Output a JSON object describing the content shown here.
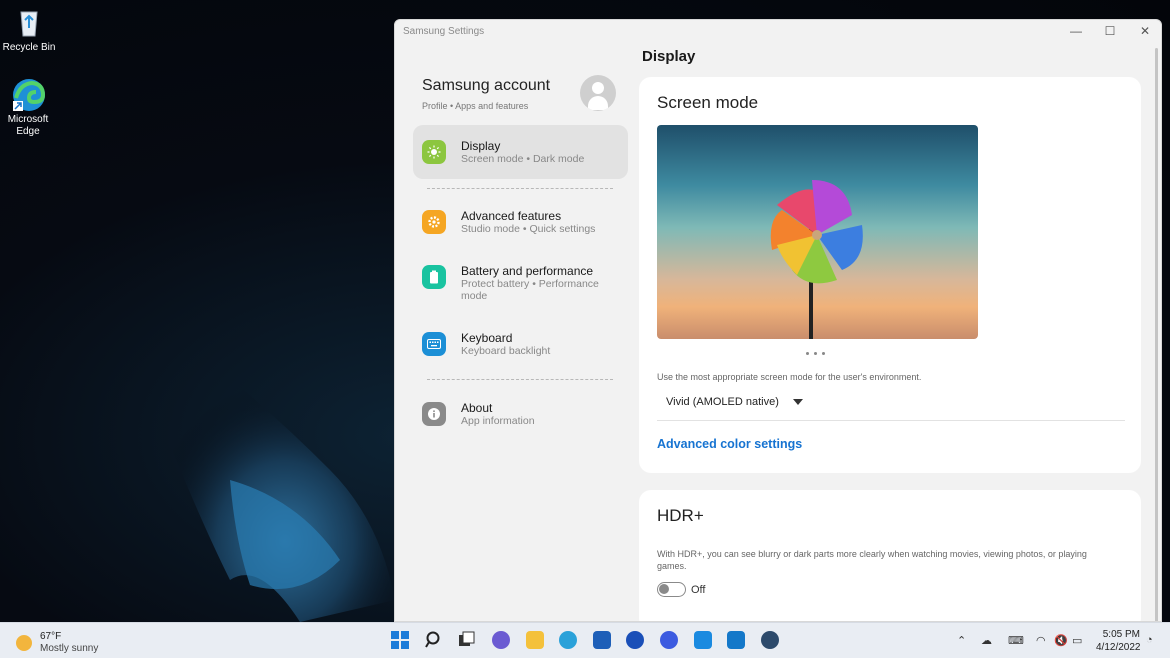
{
  "desktop": {
    "icons": [
      {
        "label": "Recycle Bin"
      },
      {
        "label": "Microsoft Edge"
      }
    ]
  },
  "window": {
    "title": "Samsung Settings",
    "controls": {
      "minimize": "—",
      "maximize": "☐",
      "close": "✕"
    }
  },
  "account": {
    "name": "Samsung account",
    "subtitle": "Profile • Apps and features"
  },
  "nav": {
    "items": [
      {
        "label": "Display",
        "sub": "Screen mode  •  Dark mode",
        "icon": "sun-icon",
        "color": "#8cc63f",
        "active": true
      },
      {
        "label": "Advanced features",
        "sub": "Studio mode  •  Quick settings",
        "icon": "gear-icon",
        "color": "#f5a623"
      },
      {
        "label": "Battery and performance",
        "sub": "Protect battery  •  Performance mode",
        "icon": "battery-icon",
        "color": "#19c3a0"
      },
      {
        "label": "Keyboard",
        "sub": "Keyboard backlight",
        "icon": "keyboard-icon",
        "color": "#1c8fd6"
      },
      {
        "label": "About",
        "sub": "App information",
        "icon": "info-icon",
        "color": "#8a8a8a"
      }
    ]
  },
  "content": {
    "page_title": "Display",
    "screen_mode": {
      "title": "Screen mode",
      "description": "Use the most appropriate screen mode for the user's environment.",
      "selected": "Vivid (AMOLED native)",
      "link": "Advanced color settings"
    },
    "hdr": {
      "title": "HDR+",
      "description": "With HDR+, you can see blurry or dark parts more clearly when watching movies, viewing photos, or playing games.",
      "toggle_state": "Off"
    }
  },
  "taskbar": {
    "weather": {
      "temp": "67°F",
      "condition": "Mostly sunny"
    },
    "clock": {
      "time": "5:05 PM",
      "date": "4/12/2022"
    }
  }
}
